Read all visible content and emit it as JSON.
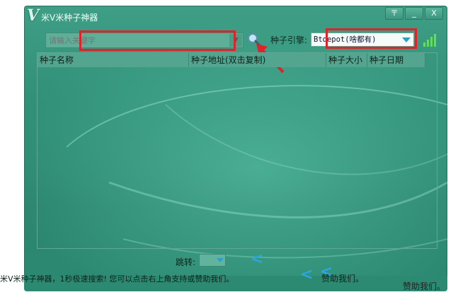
{
  "window": {
    "logo": "V",
    "title": "米V米种子神器",
    "controls": {
      "menu": "〒",
      "minimize": "_",
      "close": "X"
    }
  },
  "search": {
    "placeholder": "请输入关键字",
    "value": "",
    "button_icon": "magnifier-icon"
  },
  "engine": {
    "label": "种子引擎:",
    "selected": "Btdepot(啥都有)"
  },
  "signal_icon": "signal-bars-icon",
  "table": {
    "columns": [
      "种子名称",
      "种子地址(双击复制)",
      "种子大小",
      "种子日期"
    ],
    "rows": []
  },
  "pager": {
    "jump_label": "跳转:",
    "jump_value": "",
    "prev_icon": "chevron-left-icon"
  },
  "status": {
    "text": "米V米种子神器，1秒极速搜索! 您可以点击右上角支持或赞助我们。",
    "sponsor_label": "赞助我们。",
    "outside_label": "赞助我们。"
  },
  "colors": {
    "accent_highlight": "#e0222a",
    "window_green": "#2f8f77",
    "arrow_blue": "#2aa6e2",
    "signal_green": "#63e04e"
  }
}
